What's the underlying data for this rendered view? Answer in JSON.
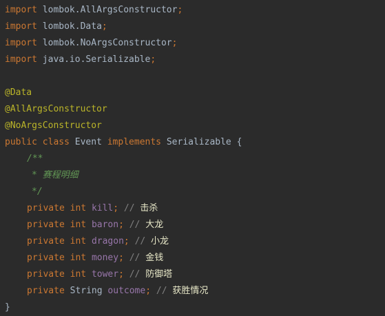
{
  "imports": [
    {
      "kw": "import",
      "path": "lombok.AllArgsConstructor",
      "end": ";"
    },
    {
      "kw": "import",
      "path": "lombok.Data",
      "end": ";"
    },
    {
      "kw": "import",
      "path": "lombok.NoArgsConstructor",
      "end": ";"
    },
    {
      "kw": "import",
      "path": "java.io.Serializable",
      "end": ";"
    }
  ],
  "annotations": [
    "@Data",
    "@AllArgsConstructor",
    "@NoArgsConstructor"
  ],
  "class_decl": {
    "mod": "public",
    "kw_class": "class",
    "name": "Event",
    "kw_implements": "implements",
    "iface": "Serializable",
    "open": "{"
  },
  "javadoc": {
    "open": "/**",
    "star": "*",
    "text": "赛程明细",
    "close": "*/"
  },
  "fields": [
    {
      "mod": "private",
      "type": "int",
      "name": "kill",
      "end": ";",
      "cmt": "//",
      "note": "击杀"
    },
    {
      "mod": "private",
      "type": "int",
      "name": "baron",
      "end": ";",
      "cmt": "//",
      "note": "大龙"
    },
    {
      "mod": "private",
      "type": "int",
      "name": "dragon",
      "end": ";",
      "cmt": "//",
      "note": "小龙"
    },
    {
      "mod": "private",
      "type": "int",
      "name": "money",
      "end": ";",
      "cmt": "//",
      "note": "金钱"
    },
    {
      "mod": "private",
      "type": "int",
      "name": "tower",
      "end": ";",
      "cmt": "//",
      "note": "防御塔"
    },
    {
      "mod": "private",
      "type": "String",
      "name": "outcome",
      "end": ";",
      "cmt": "//",
      "note": "获胜情况"
    }
  ],
  "close_brace": "}"
}
